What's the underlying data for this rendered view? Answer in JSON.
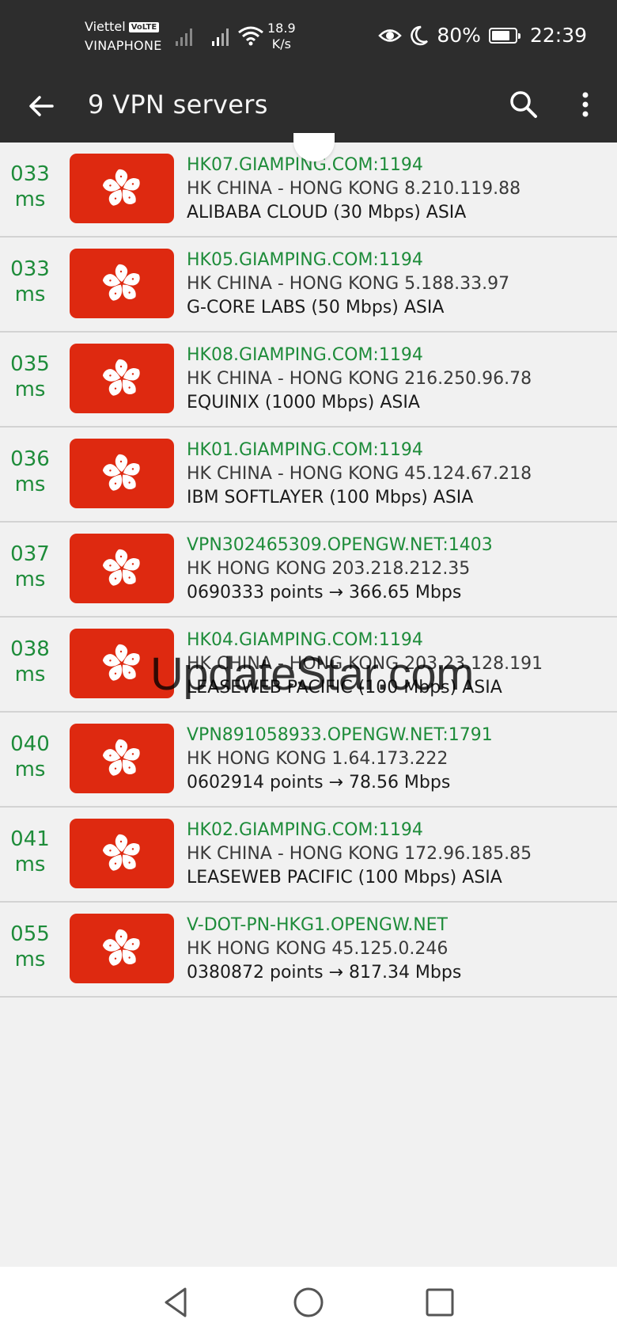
{
  "status_bar": {
    "carrier_1": "Viettel",
    "volte_badge": "VoLTE",
    "carrier_2": "VINAPHONE",
    "net_speed_value": "18.9",
    "net_speed_unit": "K/s",
    "battery_percent": "80%",
    "battery_level": 0.8,
    "time": "22:39"
  },
  "toolbar": {
    "title": "9 VPN servers",
    "back_icon": "arrow-back-icon",
    "search_icon": "search-icon",
    "more_icon": "more-vert-icon"
  },
  "colors": {
    "accent_green": "#1e8c3a",
    "flag_red": "#de2910",
    "bar_dark": "#2d2d2d"
  },
  "servers": [
    {
      "ping": "033",
      "unit": "ms",
      "host": "HK07.GIAMPING.COM:1194",
      "location": "HK CHINA - HONG KONG 8.210.119.88",
      "isp": "ALIBABA CLOUD (30 Mbps) ASIA"
    },
    {
      "ping": "033",
      "unit": "ms",
      "host": "HK05.GIAMPING.COM:1194",
      "location": "HK CHINA - HONG KONG 5.188.33.97",
      "isp": "G-CORE LABS (50 Mbps) ASIA"
    },
    {
      "ping": "035",
      "unit": "ms",
      "host": "HK08.GIAMPING.COM:1194",
      "location": "HK CHINA - HONG KONG 216.250.96.78",
      "isp": "EQUINIX (1000 Mbps) ASIA"
    },
    {
      "ping": "036",
      "unit": "ms",
      "host": "HK01.GIAMPING.COM:1194",
      "location": "HK CHINA - HONG KONG 45.124.67.218",
      "isp": "IBM SOFTLAYER (100 Mbps) ASIA"
    },
    {
      "ping": "037",
      "unit": "ms",
      "host": "VPN302465309.OPENGW.NET:1403",
      "location": "HK HONG KONG 203.218.212.35",
      "isp": "0690333 points → 366.65 Mbps"
    },
    {
      "ping": "038",
      "unit": "ms",
      "host": "HK04.GIAMPING.COM:1194",
      "location": "HK CHINA - HONG KONG 203.23.128.191",
      "isp": "LEASEWEB PACIFIC (100 Mbps) ASIA"
    },
    {
      "ping": "040",
      "unit": "ms",
      "host": "VPN891058933.OPENGW.NET:1791",
      "location": "HK HONG KONG 1.64.173.222",
      "isp": "0602914 points → 78.56 Mbps"
    },
    {
      "ping": "041",
      "unit": "ms",
      "host": "HK02.GIAMPING.COM:1194",
      "location": "HK CHINA - HONG KONG 172.96.185.85",
      "isp": "LEASEWEB PACIFIC (100 Mbps) ASIA"
    },
    {
      "ping": "055",
      "unit": "ms",
      "host": "V-DOT-PN-HKG1.OPENGW.NET",
      "location": "HK HONG KONG 45.125.0.246",
      "isp": "0380872 points → 817.34 Mbps"
    }
  ],
  "watermark": "UpdateStar.com",
  "nav_bar": {
    "back_icon": "nav-back-icon",
    "home_icon": "nav-home-icon",
    "recents_icon": "nav-recents-icon"
  }
}
